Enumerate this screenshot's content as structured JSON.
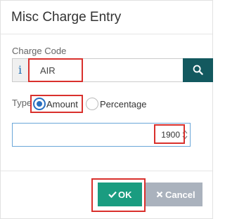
{
  "dialog": {
    "title": "Misc Charge Entry"
  },
  "charge_code": {
    "label": "Charge Code",
    "info_glyph": "i",
    "value": "AIR",
    "search_icon": "search-icon"
  },
  "type": {
    "label": "Type",
    "options": [
      {
        "label": "Amount",
        "selected": true
      },
      {
        "label": "Percentage",
        "selected": false
      }
    ]
  },
  "amount": {
    "value": "1900"
  },
  "buttons": {
    "ok": "OK",
    "cancel": "Cancel"
  },
  "colors": {
    "search_button": "#13595f",
    "ok_button": "#1a9c80",
    "cancel_button": "#aab2bd",
    "highlight": "#d9302c",
    "radio_selected": "#2a6fc0"
  }
}
